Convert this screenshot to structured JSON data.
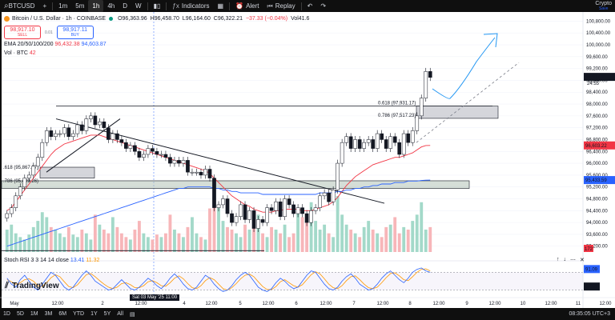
{
  "toolbar": {
    "symbol": "BTCUSD",
    "add_symbol": "+",
    "intervals": [
      "1m",
      "5m",
      "1h",
      "4h",
      "D",
      "W"
    ],
    "active_interval": "1h",
    "candle_icon": "candle-chart-icon",
    "indicators_label": "Indicators",
    "layout_icon": "templates-grid-icon",
    "alert_label": "Alert",
    "replay_label": "Replay",
    "undo": "↶",
    "redo": "↷",
    "crypto_label": "Crypto",
    "crypto_sub": "Save"
  },
  "legend": {
    "title": "Bitcoin / U.S. Dollar · 1h · COINBASE",
    "ohlc_o": "O96,363.96",
    "ohlc_h": "H96,458.70",
    "ohlc_l": "L96,164.60",
    "ohlc_c": "C96,322.21",
    "change": "−37.33 (−0.04%)",
    "vol": "Vol41.6",
    "sell_price": "98,917.10",
    "sell_label": "SELL",
    "spread": "0.01",
    "buy_price": "98,917.11",
    "buy_label": "BUY",
    "ema_label": "EMA 20/50/100/200",
    "ema_v1": "96,432.38",
    "ema_v2": "94,603.87",
    "vol_label": "Vol · BTC",
    "vol_value": "42",
    "stoch_label": "Stoch RSI 3 3 14 14 close",
    "stoch_k": "13.41",
    "stoch_d": "11.32"
  },
  "stoch_icons": [
    "↑",
    "↓",
    "⋯",
    "✕"
  ],
  "logo_text": "TradingView",
  "date_badge": "Sat 03 May '25   11:00",
  "bottom": {
    "ranges": [
      "1D",
      "5D",
      "1M",
      "3M",
      "6M",
      "YTD",
      "1Y",
      "5Y",
      "All"
    ],
    "range_icon": "date-range-icon",
    "clock": "08:35:05 UTC+3"
  },
  "colors": {
    "up": "#089981",
    "down": "#f23645",
    "ema20": "#f23645",
    "ema200": "#2962ff",
    "fib_zone": "#b2c3b6",
    "annotation_arrow": "#2196f3",
    "stoch_k": "#2962ff",
    "stoch_d": "#ff9800"
  },
  "chart_data": {
    "type": "candlestick",
    "price_axis": {
      "ticks": [
        100800,
        100400,
        100000,
        99600,
        99200,
        98800,
        98400,
        98000,
        97600,
        97200,
        96800,
        96400,
        96000,
        95600,
        95200,
        94800,
        94400,
        94000,
        93600,
        93200
      ],
      "tick_labels": [
        "100,800.00",
        "100,400.00",
        "100,000.00",
        "99,600.00",
        "99,200.00",
        "98,800.00",
        "98,400.00",
        "98,000.00",
        "97,600.00",
        "97,200.00",
        "96,800.00",
        "96,400.00",
        "96,000.00",
        "95,600.00",
        "95,200.00",
        "94,800.00",
        "94,400.00",
        "94,000.00",
        "93,600.00",
        "93,200.00"
      ],
      "ylim": [
        92950,
        101000
      ],
      "last_price": "98,917.11",
      "last_countdown": "24:55",
      "ema20_label": "96,603.22",
      "ema200_label": "95,433.59",
      "vol_label": "172"
    },
    "time_axis": {
      "labels": [
        "May",
        "12:00",
        "2",
        "12:00",
        "Sat 03 May '25",
        "4",
        "12:00",
        "5",
        "12:00",
        "6",
        "12:00",
        "7",
        "12:00",
        "8",
        "12:00",
        "9",
        "12:00",
        "10",
        "12:00",
        "11",
        "12:00"
      ]
    },
    "candles_close": [
      94300,
      94500,
      94900,
      95200,
      95500,
      95600,
      95900,
      96200,
      96700,
      97100,
      96900,
      97000,
      97000,
      97200,
      96900,
      97000,
      97300,
      97100,
      97500,
      97600,
      97300,
      97400,
      97200,
      96800,
      97000,
      96800,
      96700,
      96500,
      96600,
      96400,
      96200,
      96300,
      96500,
      96400,
      96300,
      96300,
      96200,
      96000,
      96100,
      96000,
      96100,
      95700,
      95700,
      95700,
      95600,
      95800,
      95500,
      94500,
      94600,
      94800,
      94300,
      94000,
      94200,
      94600,
      94100,
      94400,
      93800,
      94100,
      94000,
      94500,
      94400,
      94700,
      94200,
      94800,
      94600,
      94300,
      94500,
      94300,
      94000,
      94400,
      94500,
      94900,
      95000,
      94700,
      95100,
      96000,
      96700,
      96900,
      96500,
      96800,
      96500,
      96700,
      96800,
      96500,
      97000,
      96800,
      96500,
      96900,
      96700,
      96300,
      97000,
      96700,
      97100,
      97600,
      98200,
      99100,
      98900
    ],
    "volume": [
      18,
      22,
      15,
      12,
      10,
      14,
      20,
      25,
      32,
      28,
      20,
      18,
      15,
      12,
      20,
      14,
      12,
      18,
      15,
      10,
      30,
      22,
      18,
      15,
      28,
      20,
      15,
      12,
      10,
      18,
      25,
      15,
      12,
      10,
      14,
      12,
      15,
      30,
      18,
      15,
      12,
      20,
      28,
      15,
      12,
      10,
      35,
      40,
      38,
      25,
      20,
      18,
      15,
      12,
      22,
      18,
      25,
      30,
      15,
      12,
      20,
      18,
      15,
      22,
      12,
      15,
      35,
      28,
      30,
      40,
      25,
      18,
      22,
      15,
      12,
      45,
      30,
      22,
      18,
      15,
      12,
      20,
      25,
      18,
      15,
      12,
      20,
      22,
      28,
      15,
      20,
      18,
      25,
      30,
      40,
      18,
      20
    ],
    "ema20": [
      94400,
      94500,
      94700,
      94900,
      95100,
      95300,
      95500,
      95700,
      95900,
      96100,
      96300,
      96450,
      96550,
      96650,
      96700,
      96750,
      96800,
      96850,
      96900,
      96950,
      96950,
      96950,
      96900,
      96850,
      96800,
      96750,
      96700,
      96650,
      96600,
      96550,
      96500,
      96450,
      96400,
      96350,
      96300,
      96250,
      96200,
      96150,
      96100,
      96050,
      96000,
      95950,
      95900,
      95850,
      95800,
      95750,
      95650,
      95500,
      95350,
      95200,
      95050,
      94900,
      94800,
      94700,
      94600,
      94550,
      94450,
      94400,
      94350,
      94350,
      94350,
      94400,
      94400,
      94450,
      94450,
      94450,
      94450,
      94400,
      94400,
      94400,
      94450,
      94500,
      94550,
      94600,
      94700,
      94850,
      95050,
      95250,
      95400,
      95550,
      95650,
      95750,
      95850,
      95950,
      96000,
      96050,
      96100,
      96150,
      96200,
      96200,
      96250,
      96300,
      96350,
      96450,
      96550,
      96600,
      96603
    ],
    "ema200": [
      93200,
      93250,
      93300,
      93350,
      93400,
      93450,
      93500,
      93550,
      93600,
      93650,
      93700,
      93750,
      93800,
      93850,
      93900,
      93950,
      94000,
      94050,
      94100,
      94150,
      94200,
      94250,
      94300,
      94350,
      94400,
      94450,
      94500,
      94550,
      94600,
      94650,
      94700,
      94750,
      94800,
      94850,
      94900,
      94950,
      95000,
      95050,
      95100,
      95150,
      95150,
      95200,
      95200,
      95200,
      95200,
      95200,
      95200,
      95150,
      95150,
      95100,
      95100,
      95050,
      95050,
      95000,
      95000,
      95000,
      95000,
      95000,
      94950,
      94950,
      94950,
      94950,
      94950,
      94950,
      94950,
      94950,
      94950,
      94950,
      94950,
      94950,
      94950,
      95000,
      95000,
      95000,
      95000,
      95050,
      95050,
      95100,
      95100,
      95150,
      95150,
      95200,
      95200,
      95250,
      95250,
      95300,
      95300,
      95300,
      95350,
      95350,
      95350,
      95400,
      95400,
      95400,
      95420,
      95430,
      95433
    ],
    "stoch_k": [
      60,
      40,
      30,
      55,
      70,
      50,
      30,
      20,
      40,
      60,
      80,
      70,
      50,
      30,
      20,
      30,
      50,
      70,
      85,
      70,
      50,
      40,
      30,
      20,
      25,
      40,
      55,
      40,
      25,
      20,
      30,
      45,
      60,
      50,
      35,
      25,
      40,
      60,
      75,
      60,
      40,
      25,
      20,
      30,
      50,
      70,
      60,
      40,
      25,
      15,
      20,
      35,
      55,
      70,
      80,
      70,
      50,
      30,
      20,
      15,
      25,
      45,
      60,
      50,
      35,
      25,
      30,
      50,
      70,
      85,
      80,
      60,
      40,
      25,
      20,
      30,
      50,
      65,
      75,
      60,
      40,
      30,
      20,
      25,
      40,
      60,
      75,
      85,
      70,
      55,
      45,
      60,
      80,
      90,
      95,
      85,
      80
    ],
    "stoch_d": [
      55,
      48,
      40,
      45,
      55,
      58,
      50,
      35,
      32,
      45,
      62,
      72,
      65,
      48,
      32,
      28,
      38,
      55,
      72,
      76,
      65,
      52,
      40,
      30,
      25,
      30,
      42,
      45,
      38,
      28,
      28,
      35,
      48,
      52,
      45,
      35,
      33,
      45,
      60,
      68,
      58,
      42,
      28,
      25,
      35,
      52,
      62,
      55,
      40,
      25,
      20,
      28,
      42,
      58,
      70,
      74,
      65,
      48,
      32,
      22,
      22,
      32,
      48,
      55,
      45,
      35,
      30,
      38,
      55,
      72,
      82,
      75,
      58,
      40,
      28,
      25,
      35,
      52,
      65,
      68,
      55,
      40,
      28,
      25,
      30,
      45,
      62,
      76,
      78,
      68,
      55,
      52,
      65,
      80,
      90,
      92,
      85
    ],
    "levels": {
      "fib_618_upper": "0.618 (97,931.17)",
      "fib_786_upper": "0.786 (97,517.23)",
      "fib_618_lower": ".618 (95,867.27)",
      "fib_786_lower": ".786 (95,409.26)"
    },
    "stoch_axis": [
      "91.09",
      "32.53"
    ]
  }
}
